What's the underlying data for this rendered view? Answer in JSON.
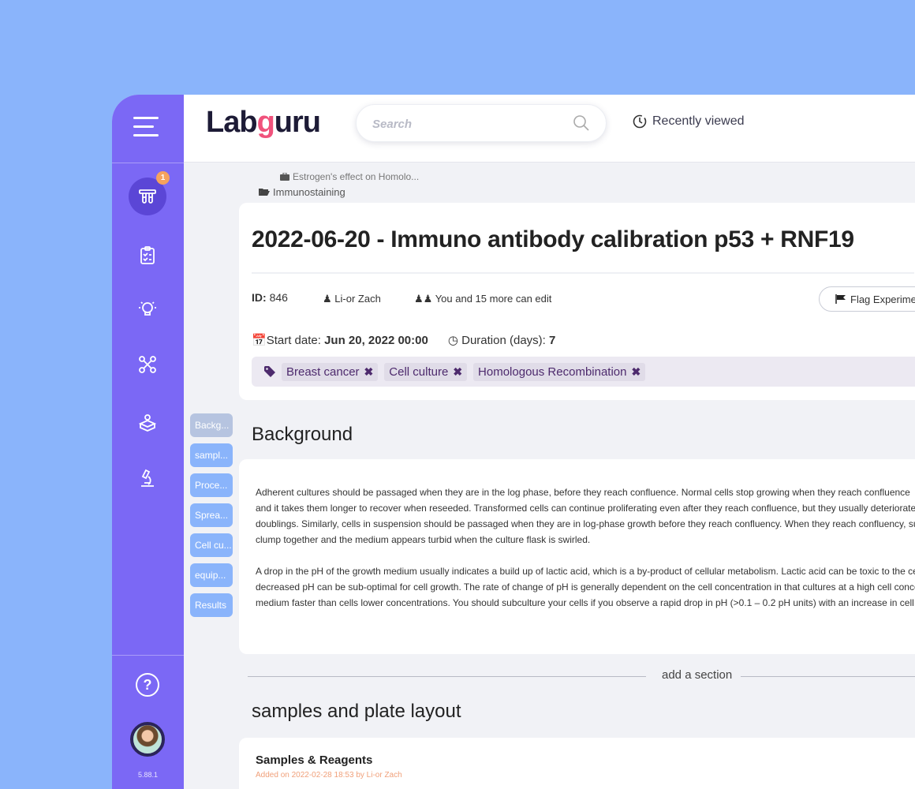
{
  "app": {
    "logo_left": "Lab",
    "logo_g": "g",
    "logo_right": "uru",
    "version": "5.88.1"
  },
  "header": {
    "search_placeholder": "Search",
    "recently_viewed": "Recently viewed"
  },
  "sidebar": {
    "badge_count": "1",
    "help_label": "?"
  },
  "breadcrumbs": {
    "project": "Estrogen's effect on Homolo...",
    "folder": "Immunostaining"
  },
  "experiment": {
    "title": "2022-06-20 - Immuno antibody calibration p53 + RNF19",
    "id_label": "ID:",
    "id_value": "846",
    "owner": "Li-or Zach",
    "sharing": "You and 15 more can edit",
    "flag_label": "Flag Experiment",
    "start_label": "Start date:",
    "start_value": "Jun 20, 2022 00:00",
    "duration_label": "Duration (days):",
    "duration_value": "7",
    "tags": [
      "Breast cancer",
      "Cell culture",
      "Homologous Recombination"
    ],
    "tag_remove_glyph": "✖"
  },
  "section_tabs": [
    "Backg...",
    "sampl...",
    "Proce...",
    "Sprea...",
    "Cell cu...",
    "equip...",
    "Results"
  ],
  "background": {
    "heading": "Background",
    "lines": [
      "Adherent cultures should be passaged when they are in the log phase, before they reach confluence.  Normal cells stop growing when they reach confluence",
      "and it takes them longer to recover when reseeded.  Transformed cells can continue proliferating even after they reach confluence, but they usually deteriorate after about two",
      "doublings. Similarly, cells in suspension should be passaged when they are in log-phase growth before they reach confluency.  When they reach confluency, suspension cells",
      "clump together and the medium appears turbid when the culture flask is swirled.",
      "A drop in the pH of the growth medium usually indicates a build up of lactic acid, which is a by-product of cellular metabolism.  Lactic acid can be toxic to the cells, and the",
      "decreased pH can be sub-optimal for cell growth.  The rate of change of pH is generally dependent on the cell concentration in that cultures at a high cell concentration exhaust",
      "medium faster than cells lower concentrations.  You should subculture your cells if you observe a rapid drop in pH (>0.1 – 0.2 pH units) with an increase in cell concentration."
    ]
  },
  "add_section": "add a section",
  "samples": {
    "heading": "samples and plate layout",
    "card_title": "Samples & Reagents",
    "card_sub": "Added on 2022-02-28 18:53 by Li-or Zach"
  }
}
